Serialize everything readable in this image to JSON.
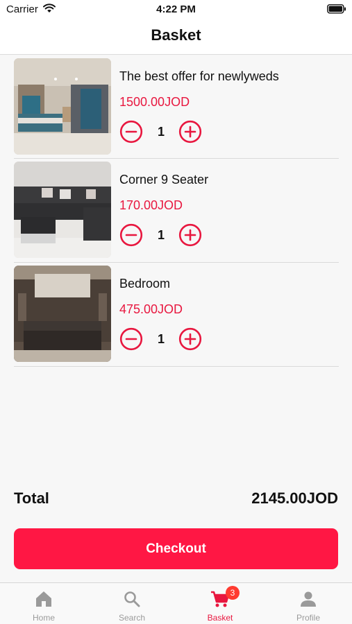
{
  "status_bar": {
    "carrier": "Carrier",
    "time": "4:22 PM"
  },
  "header": {
    "title": "Basket"
  },
  "items": [
    {
      "title": "The best offer for newlyweds",
      "price": "1500.00JOD",
      "quantity": "1",
      "image": "bedroom-set-photo"
    },
    {
      "title": "Corner 9 Seater",
      "price": "170.00JOD",
      "quantity": "1",
      "image": "corner-sofa-photo"
    },
    {
      "title": "Bedroom",
      "price": "475.00JOD",
      "quantity": "1",
      "image": "bed-headboard-photo"
    }
  ],
  "summary": {
    "total_label": "Total",
    "total_value": "2145.00JOD"
  },
  "checkout": {
    "label": "Checkout"
  },
  "tabs": [
    {
      "label": "Home",
      "icon": "home-icon"
    },
    {
      "label": "Search",
      "icon": "search-icon"
    },
    {
      "label": "Basket",
      "icon": "cart-icon",
      "badge": "3",
      "active": true
    },
    {
      "label": "Profile",
      "icon": "person-icon"
    }
  ],
  "colors": {
    "accent": "#ff1744",
    "price": "#e8173f",
    "inactive_tab": "#9a9a9a"
  }
}
